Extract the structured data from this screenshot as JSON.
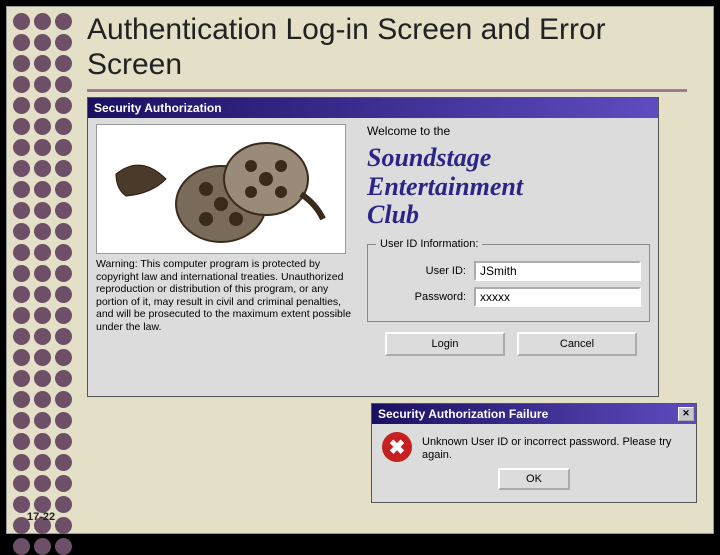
{
  "slide": {
    "title": "Authentication Log-in Screen and Error Screen",
    "number": "17-22"
  },
  "login": {
    "titlebar": "Security Authorization",
    "welcome": "Welcome to the",
    "brand_line1": "Soundstage",
    "brand_line2": "Entertainment",
    "brand_line3": "Club",
    "warning": "Warning: This computer program is protected by copyright law and international treaties. Unauthorized reproduction or distribution of this program, or any portion of it, may result in civil and criminal penalties, and will be prosecuted to the maximum extent possible under the law.",
    "fieldset_legend": "User ID Information:",
    "userid_label": "User ID:",
    "userid_value": "JSmith",
    "password_label": "Password:",
    "password_value": "xxxxx",
    "login_btn": "Login",
    "cancel_btn": "Cancel"
  },
  "error": {
    "titlebar": "Security Authorization Failure",
    "message": "Unknown User ID or incorrect password. Please try again.",
    "ok_btn": "OK"
  }
}
